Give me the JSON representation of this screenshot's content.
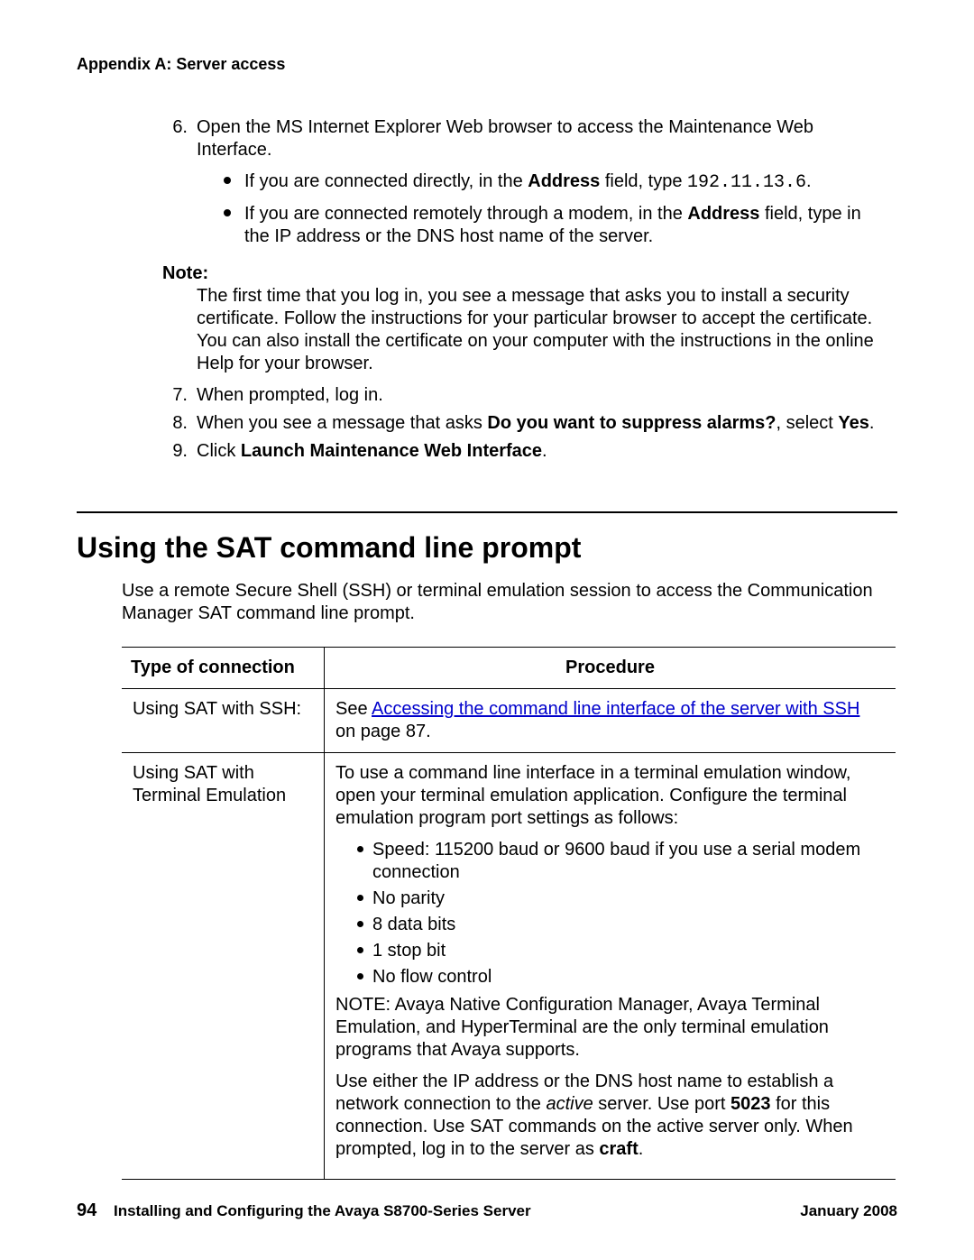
{
  "header": {
    "appendix": "Appendix A: Server access"
  },
  "steps": {
    "s6": {
      "num": "6.",
      "text_a": "Open the MS Internet Explorer Web browser to access the Maintenance Web Interface.",
      "b1_a": "If you are connected directly, in the ",
      "b1_b": "Address",
      "b1_c": " field, type ",
      "b1_d": "192.11.13.6",
      "b1_e": ".",
      "b2_a": "If you are connected remotely through a modem, in the ",
      "b2_b": "Address",
      "b2_c": " field, type in the IP address or the DNS host name of the server."
    },
    "note": {
      "label": "Note:",
      "body": "The first time that you log in, you see a message that asks you to install a security certificate. Follow the instructions for your particular browser to accept the certificate. You can also install the certificate on your computer with the instructions in the online Help for your browser."
    },
    "s7": {
      "num": "7.",
      "text": "When prompted, log in."
    },
    "s8": {
      "num": "8.",
      "a": "When you see a message that asks ",
      "b": "Do you want to suppress alarms?",
      "c": ", select ",
      "d": "Yes",
      "e": "."
    },
    "s9": {
      "num": "9.",
      "a": "Click ",
      "b": "Launch Maintenance Web Interface",
      "c": "."
    }
  },
  "section": {
    "heading": "Using the SAT command line prompt",
    "intro": "Use a remote Secure Shell (SSH) or terminal emulation session to access the Communication Manager SAT command line prompt."
  },
  "table": {
    "th1": "Type of connection",
    "th2": "Procedure",
    "row1": {
      "c1": "Using SAT with SSH:",
      "c2_a": "See ",
      "c2_link": "Accessing the command line interface of the server with SSH",
      "c2_b": " on page 87."
    },
    "row2": {
      "c1": "Using SAT with Terminal Emulation",
      "p1": "To use a command line interface in a terminal emulation window, open your terminal emulation application. Configure the terminal emulation program port settings as follows:",
      "bl1": "Speed: 115200 baud or 9600 baud if you use a serial modem connection",
      "bl2": "No parity",
      "bl3": "8 data bits",
      "bl4": "1 stop bit",
      "bl5": "No flow control",
      "p2": "NOTE: Avaya Native Configuration Manager, Avaya Terminal Emulation, and HyperTerminal are the only terminal emulation programs that Avaya supports.",
      "p3_a": "Use either the IP address or the DNS host name to establish a network connection to the ",
      "p3_b": "active",
      "p3_c": " server. Use port ",
      "p3_d": "5023",
      "p3_e": " for this connection. Use SAT commands on the active server only. When prompted, log in to the server as ",
      "p3_f": "craft",
      "p3_g": "."
    }
  },
  "footer": {
    "pagenum": "94",
    "title": "Installing and Configuring the Avaya S8700-Series Server",
    "date": "January 2008"
  }
}
